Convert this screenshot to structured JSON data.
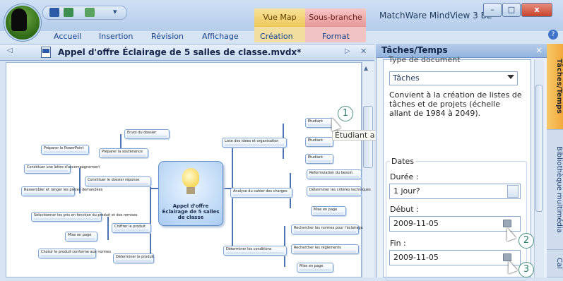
{
  "window": {
    "title": "MatchWare MindView 3 BE -",
    "btn_min": "–",
    "btn_max": "□",
    "btn_close": "x"
  },
  "contextual_tabs": {
    "vue_map": "Vue Map",
    "sous_branche": "Sous-branche"
  },
  "ribbon": {
    "tabs": [
      "Accueil",
      "Insertion",
      "Révision",
      "Affichage",
      "Création",
      "Format"
    ]
  },
  "document": {
    "title": "Appel d'offre Éclairage de 5 salles de classe.mvdx*",
    "nav_left": "◁",
    "nav_right": "▷",
    "close": "✕"
  },
  "mindmap": {
    "center": "Appel d'offre Éclairage de 5 salles de classe",
    "branches": [
      "Liste des idées et organisation",
      "Analyse du cahier des charges",
      "Déterminer les conditions",
      "Constituer le dossier réponse",
      "Chiffrer le produit",
      "Déterminer le produit"
    ],
    "subnodes": [
      "Envoi du dossier",
      "Préparer la soutenance",
      "Préparer le PowerPoint",
      "Constituer une lettre d'accompagnement",
      "Rassembler et ranger les pièces demandées",
      "Sélectionner les prix en fonction du produit et des remises",
      "Mise en page",
      "Choisir le produit conforme aux normes",
      "Étudiant",
      "Étudiant",
      "Étudiant",
      "Reformulation du besoin",
      "Déterminer les critères techniques",
      "Mise en page",
      "Rechercher les normes pour l'éclairage",
      "Rechercher les règlements",
      "Mise en page"
    ],
    "tooltip": "Étudiant a"
  },
  "callouts": [
    "1",
    "2",
    "3"
  ],
  "panel": {
    "title": "Tâches/Temps",
    "close": "×",
    "type_label": "Type de document",
    "type_value": "Tâches",
    "type_description": "Convient à la création de listes de tâches et de projets (échelle allant de 1984 à 2049).",
    "dates_label": "Dates",
    "duree_label": "Durée :",
    "duree_value": "1 jour?",
    "debut_label": "Début :",
    "debut_value": "2009-11-05",
    "fin_label": "Fin :",
    "fin_value": "2009-11-05"
  },
  "side_tabs": [
    "Tâches/Temps",
    "Bibliothèque multimédia",
    "Cal"
  ],
  "colors": {
    "accent": "#15428b",
    "vue_map_tab": "#eec75a",
    "sous_branche_tab": "#e69797",
    "callout": "#2f7f6d",
    "active_side_tab": "#f2a93a"
  }
}
